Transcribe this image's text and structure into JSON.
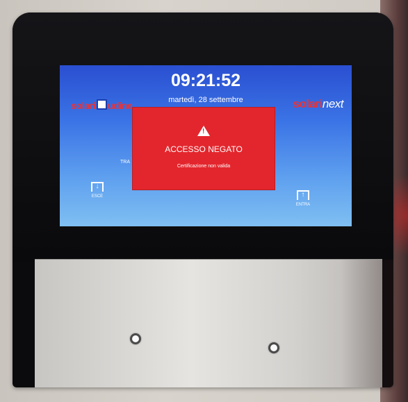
{
  "terminal": {
    "brand_left_a": "solari",
    "brand_left_b": "udine",
    "brand_right_a": "solari",
    "brand_right_b": "next",
    "time": "09:21:52",
    "date": "martedì, 28 settembre",
    "side_text": "TRA",
    "dialog": {
      "title": "ACCESSO NEGATO",
      "message": "Certificazione non valida",
      "icon": "warning-icon"
    },
    "exit_label": "ESCE",
    "enter_label": "ENTRA",
    "colors": {
      "screen_top": "#2a4fd1",
      "screen_bottom": "#7fbff2",
      "dialog": "#e3262d",
      "brand": "#e8343a"
    }
  }
}
